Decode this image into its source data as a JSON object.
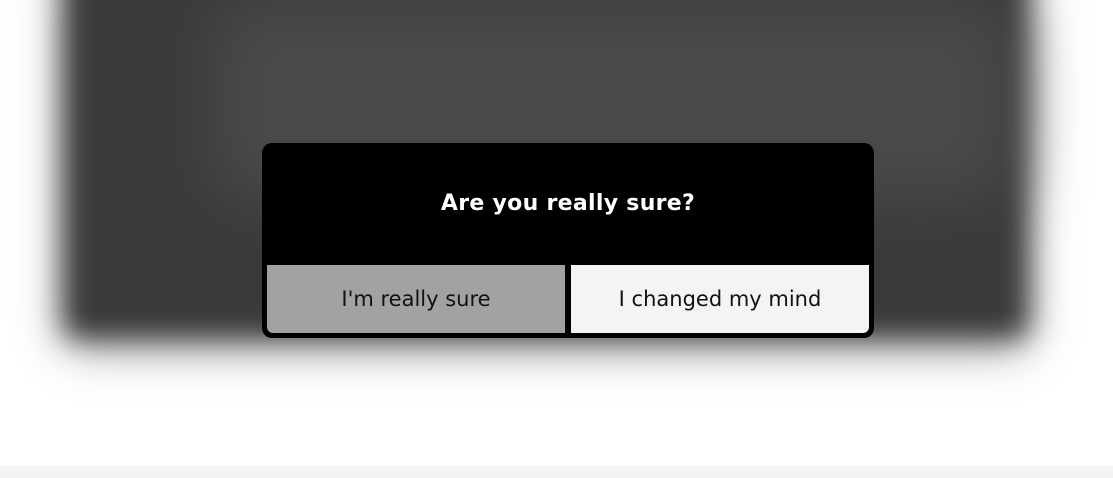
{
  "dialog": {
    "title": "Are you really sure?",
    "confirm_label": "I'm really sure",
    "cancel_label": "I changed my mind"
  },
  "colors": {
    "dialog_background": "#000000",
    "confirm_button": "#a2a2a2",
    "cancel_button": "#f4f4f4",
    "backdrop": "#3a3a3a"
  }
}
